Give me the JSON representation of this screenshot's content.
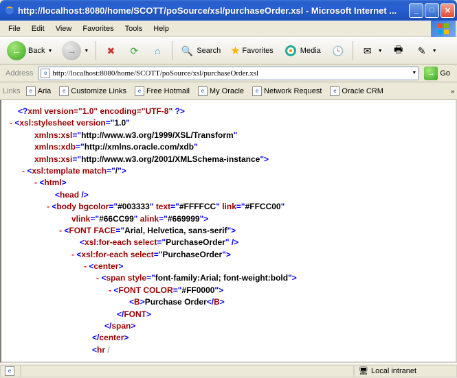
{
  "title": "http://localhost:8080/home/SCOTT/poSource/xsl/purchaseOrder.xsl - Microsoft Internet ...",
  "menu": {
    "file": "File",
    "edit": "Edit",
    "view": "View",
    "favorites": "Favorites",
    "tools": "Tools",
    "help": "Help"
  },
  "toolbar": {
    "back": "Back",
    "search": "Search",
    "favorites": "Favorites",
    "media": "Media"
  },
  "address": {
    "label": "Address",
    "value": "http://localhost:8080/home/SCOTT/poSource/xsl/purchaseOrder.xsl",
    "go": "Go"
  },
  "links": {
    "label": "Links",
    "aria": "Aria",
    "customize": "Customize Links",
    "hotmail": "Free Hotmail",
    "oracle": "My Oracle",
    "network": "Network Request",
    "crm": "Oracle CRM"
  },
  "xml": {
    "decl_open": "<?",
    "decl_name": "xml version=\"1.0\" encoding=\"UTF-8\"",
    "decl_close": "?>",
    "ss_open": "xsl:stylesheet version",
    "ss_ver": "1.0",
    "ns_xsl_a": "xmlns:xsl",
    "ns_xsl_v": "http://www.w3.org/1999/XSL/Transform",
    "ns_xdb_a": "xmlns:xdb",
    "ns_xdb_v": "http://xmlns.oracle.com/xdb",
    "ns_xsi_a": "xmlns:xsi",
    "ns_xsi_v": "http://www.w3.org/2001/XMLSchema-instance",
    "tmpl_tag": "xsl:template match",
    "tmpl_val": "/",
    "html": "html",
    "head": "head",
    "body_tag": "body bgcolor",
    "body_bg": "#003333",
    "body_text_l": "text",
    "body_text": "#FFFFCC",
    "body_link_l": "link",
    "body_link": "#FFCC00",
    "body_vlink_l": "vlink",
    "body_vlink": "#66CC99",
    "body_alink_l": "alink",
    "body_alink": "#669999",
    "font_tag": "FONT FACE",
    "font_val": "Arial, Helvetica, sans-serif",
    "fe_tag": "xsl:for-each select",
    "fe_val": "PurchaseOrder",
    "center": "center",
    "span_tag": "span style",
    "span_val": "font-family:Arial; font-weight:bold",
    "fontc_tag": "FONT COLOR",
    "fontc_val": "#FF0000",
    "b_tag": "B",
    "b_text": "Purchase Order",
    "efont": "FONT",
    "espan": "span",
    "ecenter": "center",
    "hr": "hr"
  },
  "status": {
    "zone": "Local intranet"
  }
}
